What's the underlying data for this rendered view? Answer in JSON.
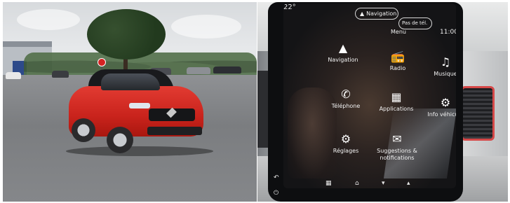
{
  "screen": {
    "temperature": "22°",
    "pill_navigation": "Navigation",
    "pill_pas_de_tel": "Pas de tél.",
    "menu_title": "Menu",
    "time": "11:00",
    "tiles": [
      {
        "label": "Navigation",
        "icon": "navigation-arrow-icon"
      },
      {
        "label": "Radio",
        "icon": "radio-icon"
      },
      {
        "label": "Musique",
        "icon": "music-note-icon"
      },
      {
        "label": "Téléphone",
        "icon": "phone-icon"
      },
      {
        "label": "Applications",
        "icon": "apps-grid-icon"
      },
      {
        "label": "Info véhicule",
        "icon": "vehicle-info-icon"
      },
      {
        "label": "Réglages",
        "icon": "gear-icon"
      },
      {
        "label": "Suggestions & notifications",
        "icon": "chat-bubble-icon"
      }
    ],
    "bottom_icons": [
      "back-icon",
      "grid-icon",
      "home-icon",
      "volume-down-icon",
      "volume-up-icon",
      "power-icon"
    ]
  },
  "colors": {
    "car_red": "#c9231c",
    "screen_black": "#0d0e10",
    "accent_vent_red": "#d64848"
  }
}
